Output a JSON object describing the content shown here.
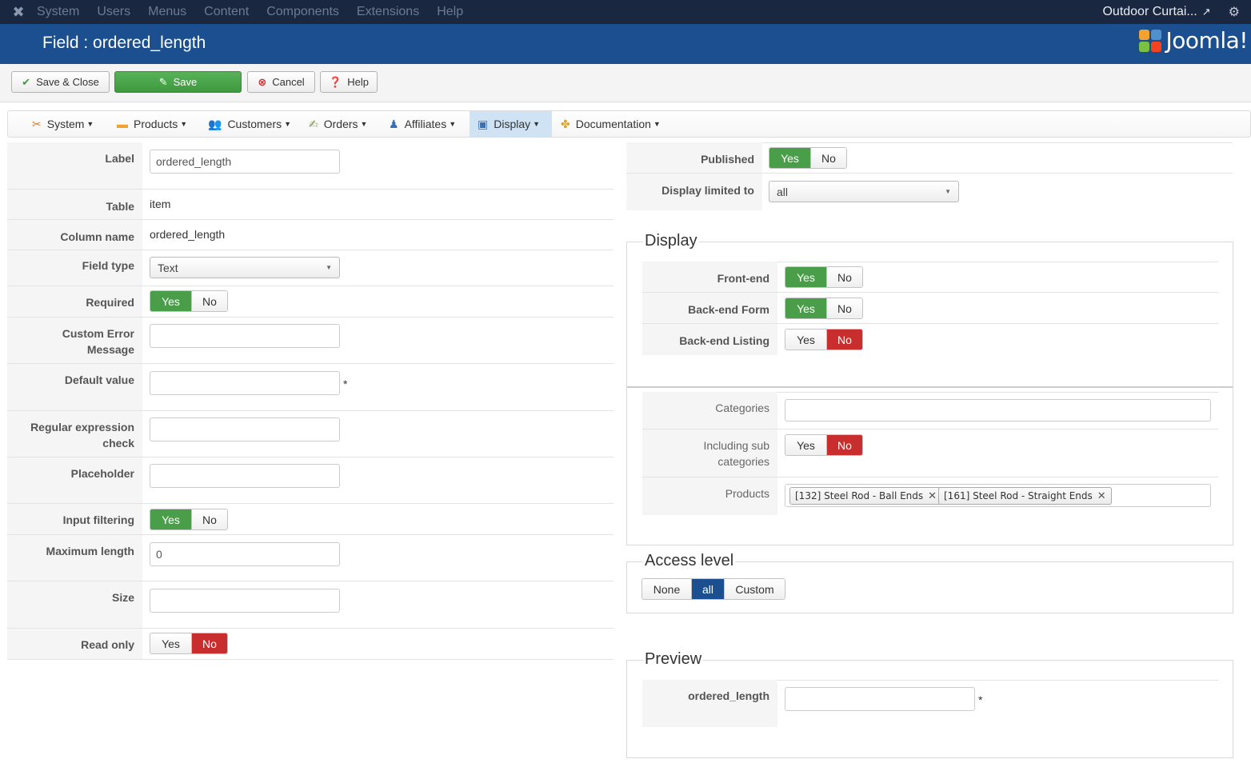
{
  "topnav": {
    "menu": [
      "System",
      "Users",
      "Menus",
      "Content",
      "Components",
      "Extensions",
      "Help"
    ],
    "site_name": "Outdoor Curtai...",
    "icons": {
      "logo": "joomla-icon",
      "external": "external-link-icon",
      "settings": "gear-icon"
    }
  },
  "header": {
    "title": "Field : ordered_length",
    "brand": "Joomla!"
  },
  "toolbar": {
    "save_close": "Save & Close",
    "save": "Save",
    "cancel": "Cancel",
    "help": "Help"
  },
  "component_menu": [
    {
      "label": "System",
      "icon": "tools-icon"
    },
    {
      "label": "Products",
      "icon": "box-icon"
    },
    {
      "label": "Customers",
      "icon": "users-icon"
    },
    {
      "label": "Orders",
      "icon": "document-icon"
    },
    {
      "label": "Affiliates",
      "icon": "affiliate-icon"
    },
    {
      "label": "Display",
      "icon": "display-icon",
      "active": true
    },
    {
      "label": "Documentation",
      "icon": "documentation-icon"
    }
  ],
  "form_left": {
    "label": {
      "label": "Label",
      "value": "ordered_length"
    },
    "table": {
      "label": "Table",
      "value": "item"
    },
    "column_name": {
      "label": "Column name",
      "value": "ordered_length"
    },
    "field_type": {
      "label": "Field type",
      "value": "Text"
    },
    "required": {
      "label": "Required",
      "yes": "Yes",
      "no": "No",
      "selected": "Yes"
    },
    "custom_error": {
      "label_line1": "Custom Error",
      "label_line2": "Message",
      "value": ""
    },
    "default_value": {
      "label": "Default value",
      "value": "",
      "marker": "*"
    },
    "regex": {
      "label_line1": "Regular expression",
      "label_line2": "check",
      "value": ""
    },
    "placeholder": {
      "label": "Placeholder",
      "value": ""
    },
    "input_filtering": {
      "label": "Input filtering",
      "yes": "Yes",
      "no": "No",
      "selected": "Yes"
    },
    "max_length": {
      "label": "Maximum length",
      "value": "0"
    },
    "size": {
      "label": "Size",
      "value": ""
    },
    "read_only": {
      "label": "Read only",
      "yes": "Yes",
      "no": "No",
      "selected": "No"
    }
  },
  "form_right": {
    "published": {
      "label": "Published",
      "yes": "Yes",
      "no": "No",
      "selected": "Yes"
    },
    "display_limited": {
      "label": "Display limited to",
      "value": "all"
    },
    "display": {
      "legend": "Display",
      "front_end": {
        "label": "Front-end",
        "yes": "Yes",
        "no": "No",
        "selected": "Yes"
      },
      "back_end_form": {
        "label": "Back-end Form",
        "yes": "Yes",
        "no": "No",
        "selected": "Yes"
      },
      "back_end_listing": {
        "label": "Back-end Listing",
        "yes": "Yes",
        "no": "No",
        "selected": "No"
      },
      "categories": {
        "label": "Categories",
        "value": ""
      },
      "including_sub": {
        "label_line1": "Including sub",
        "label_line2": "categories",
        "yes": "Yes",
        "no": "No",
        "selected": "No"
      },
      "products": {
        "label": "Products",
        "tags": [
          "[132] Steel Rod - Ball Ends",
          "[161] Steel Rod - Straight Ends"
        ]
      }
    },
    "access": {
      "legend": "Access level",
      "options": [
        "None",
        "all",
        "Custom"
      ],
      "selected": "all"
    },
    "preview": {
      "legend": "Preview",
      "label": "ordered_length",
      "value": "",
      "marker": "*"
    }
  },
  "colors": {
    "topnav_bg": "#1a2740",
    "header_bg": "#1b4f8f",
    "green": "#4a9e4a",
    "red": "#c92e2e",
    "blue": "#1b4f8f"
  }
}
